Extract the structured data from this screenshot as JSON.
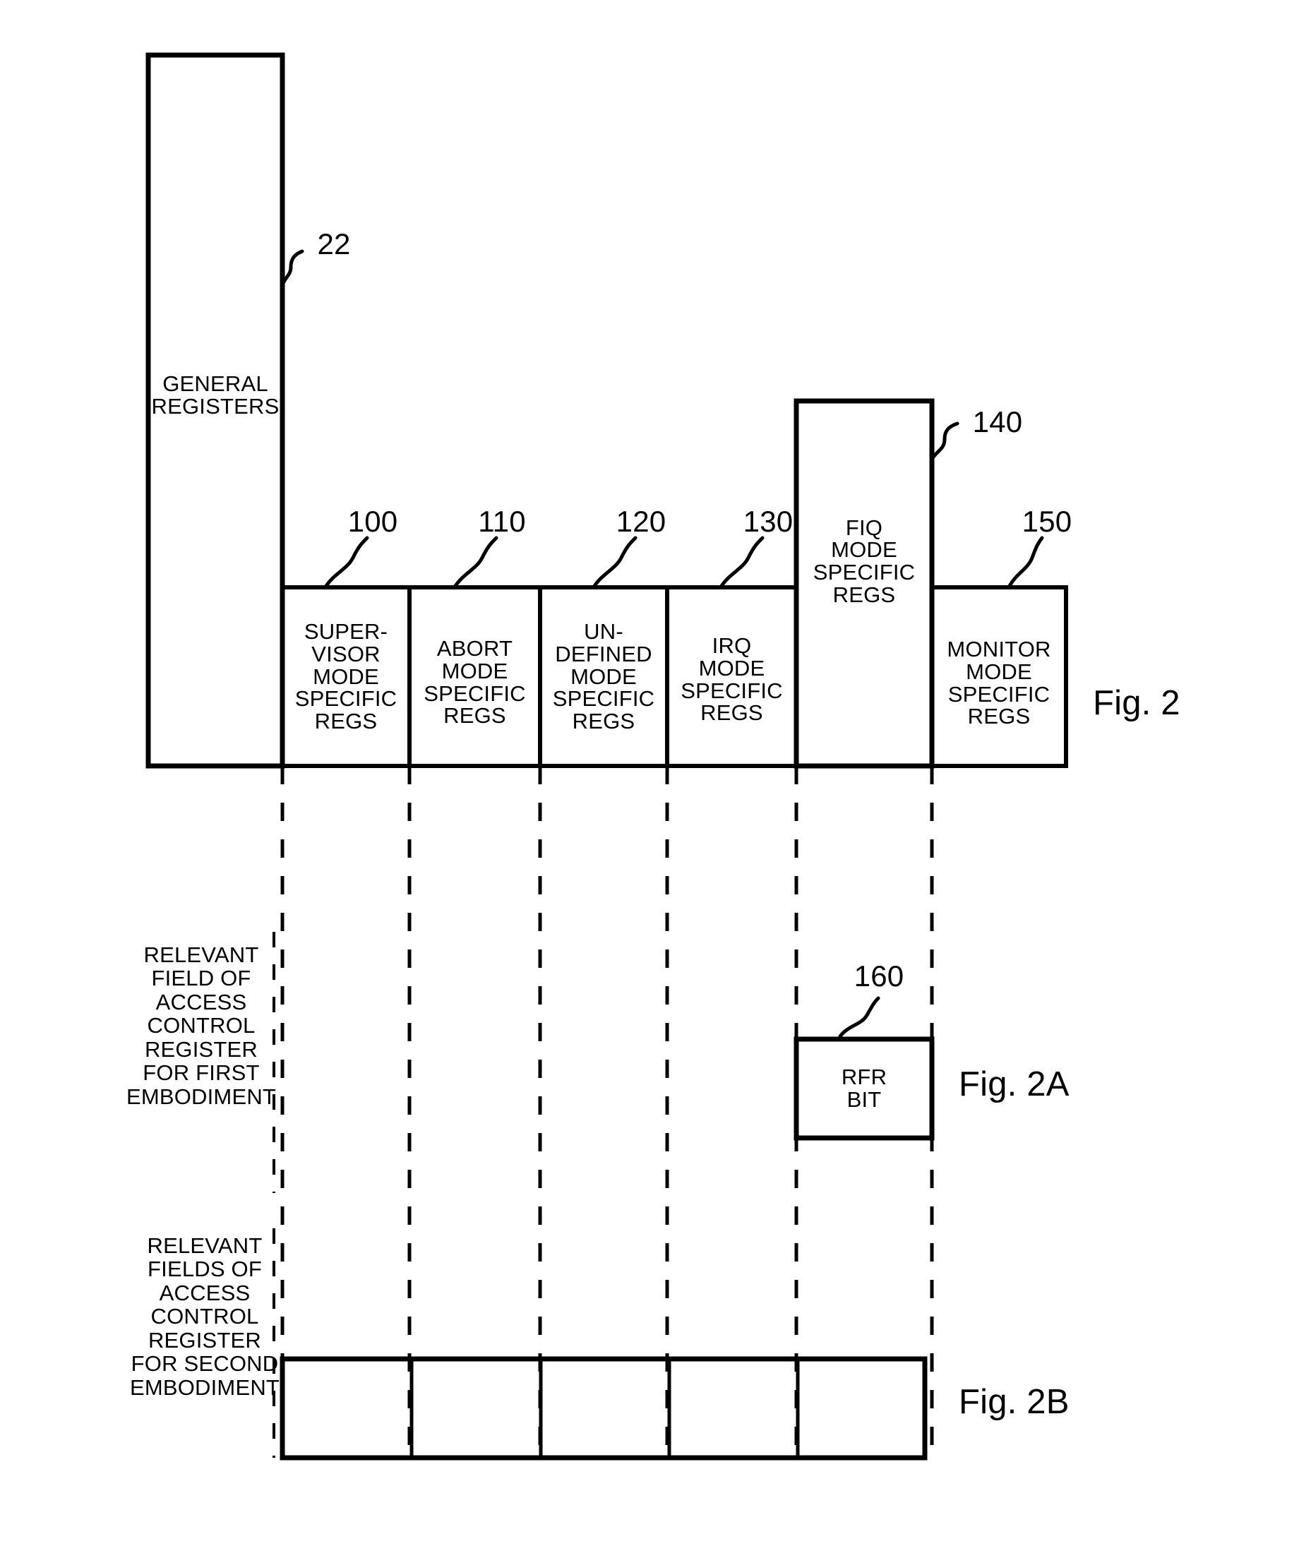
{
  "figure": {
    "main_label": "Fig. 2",
    "sub_label_a": "Fig. 2A",
    "sub_label_b": "Fig. 2B"
  },
  "register_bank": {
    "general_registers": {
      "label": "GENERAL\nREGISTERS",
      "ref": "22"
    },
    "mode_registers": [
      {
        "label": "SUPER-\nVISOR\nMODE\nSPECIFIC\nREGS",
        "ref": "100",
        "name": "supervisor-mode"
      },
      {
        "label": "ABORT\nMODE\nSPECIFIC\nREGS",
        "ref": "110",
        "name": "abort-mode"
      },
      {
        "label": "UN-\nDEFINED\nMODE\nSPECIFIC\nREGS",
        "ref": "120",
        "name": "undefined-mode"
      },
      {
        "label": "IRQ\nMODE\nSPECIFIC\nREGS",
        "ref": "130",
        "name": "irq-mode"
      },
      {
        "label": "FIQ\nMODE\nSPECIFIC\nREGS",
        "ref": "140",
        "name": "fiq-mode"
      },
      {
        "label": "MONITOR\nMODE\nSPECIFIC\nREGS",
        "ref": "150",
        "name": "monitor-mode"
      }
    ]
  },
  "first_embodiment": {
    "caption": "RELEVANT\nFIELD OF\nACCESS\nCONTROL\nREGISTER\nFOR FIRST\nEMBODIMENT",
    "rfr_bit": {
      "label": "RFR\nBIT",
      "ref": "160"
    }
  },
  "second_embodiment": {
    "caption": "RELEVANT\nFIELDS OF\nACCESS\nCONTROL\nREGISTER\nFOR SECOND\nEMBODIMENT",
    "fields": [
      "",
      "",
      "",
      "",
      ""
    ]
  },
  "style": {
    "line_color": "#000000",
    "background": "#ffffff"
  }
}
